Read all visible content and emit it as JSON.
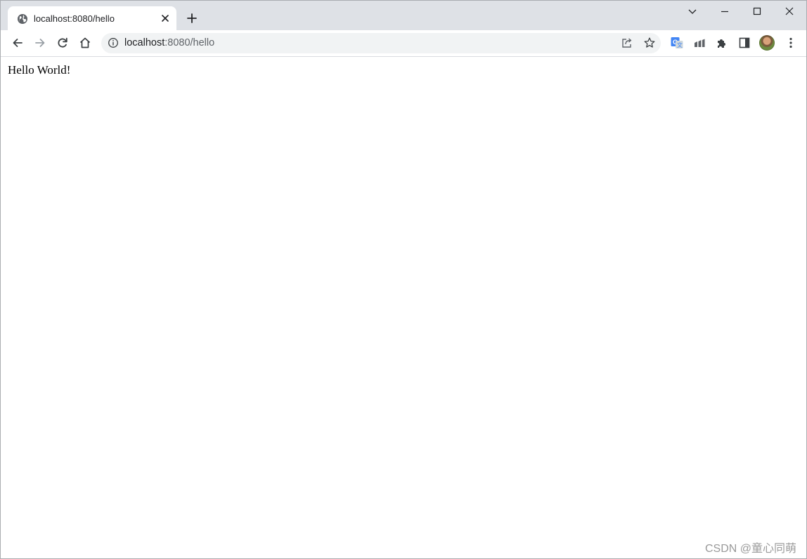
{
  "tab": {
    "title": "localhost:8080/hello",
    "favicon": "globe-icon"
  },
  "window_controls": [
    "tab-search-icon",
    "minimize-icon",
    "maximize-icon",
    "close-icon"
  ],
  "toolbar": {
    "icons": [
      "back-arrow-icon",
      "forward-arrow-icon",
      "reload-icon",
      "home-icon"
    ],
    "extension_icons": [
      "translate-icon",
      "analytics-icon",
      "extensions-puzzle-icon",
      "side-panel-icon",
      "profile-avatar",
      "kebab-menu-icon"
    ]
  },
  "omnibox": {
    "info_icon": "info-icon",
    "url_host": "localhost",
    "url_rest": ":8080/hello",
    "action_icons": [
      "share-icon",
      "bookmark-star-icon"
    ]
  },
  "page": {
    "text": "Hello World!"
  },
  "watermark": "CSDN @童心同萌",
  "colors": {
    "tabstrip_bg": "#dee1e6",
    "omnibox_bg": "#f1f3f4",
    "icon": "#5f6368",
    "disabled_icon": "#9aa0a6"
  }
}
